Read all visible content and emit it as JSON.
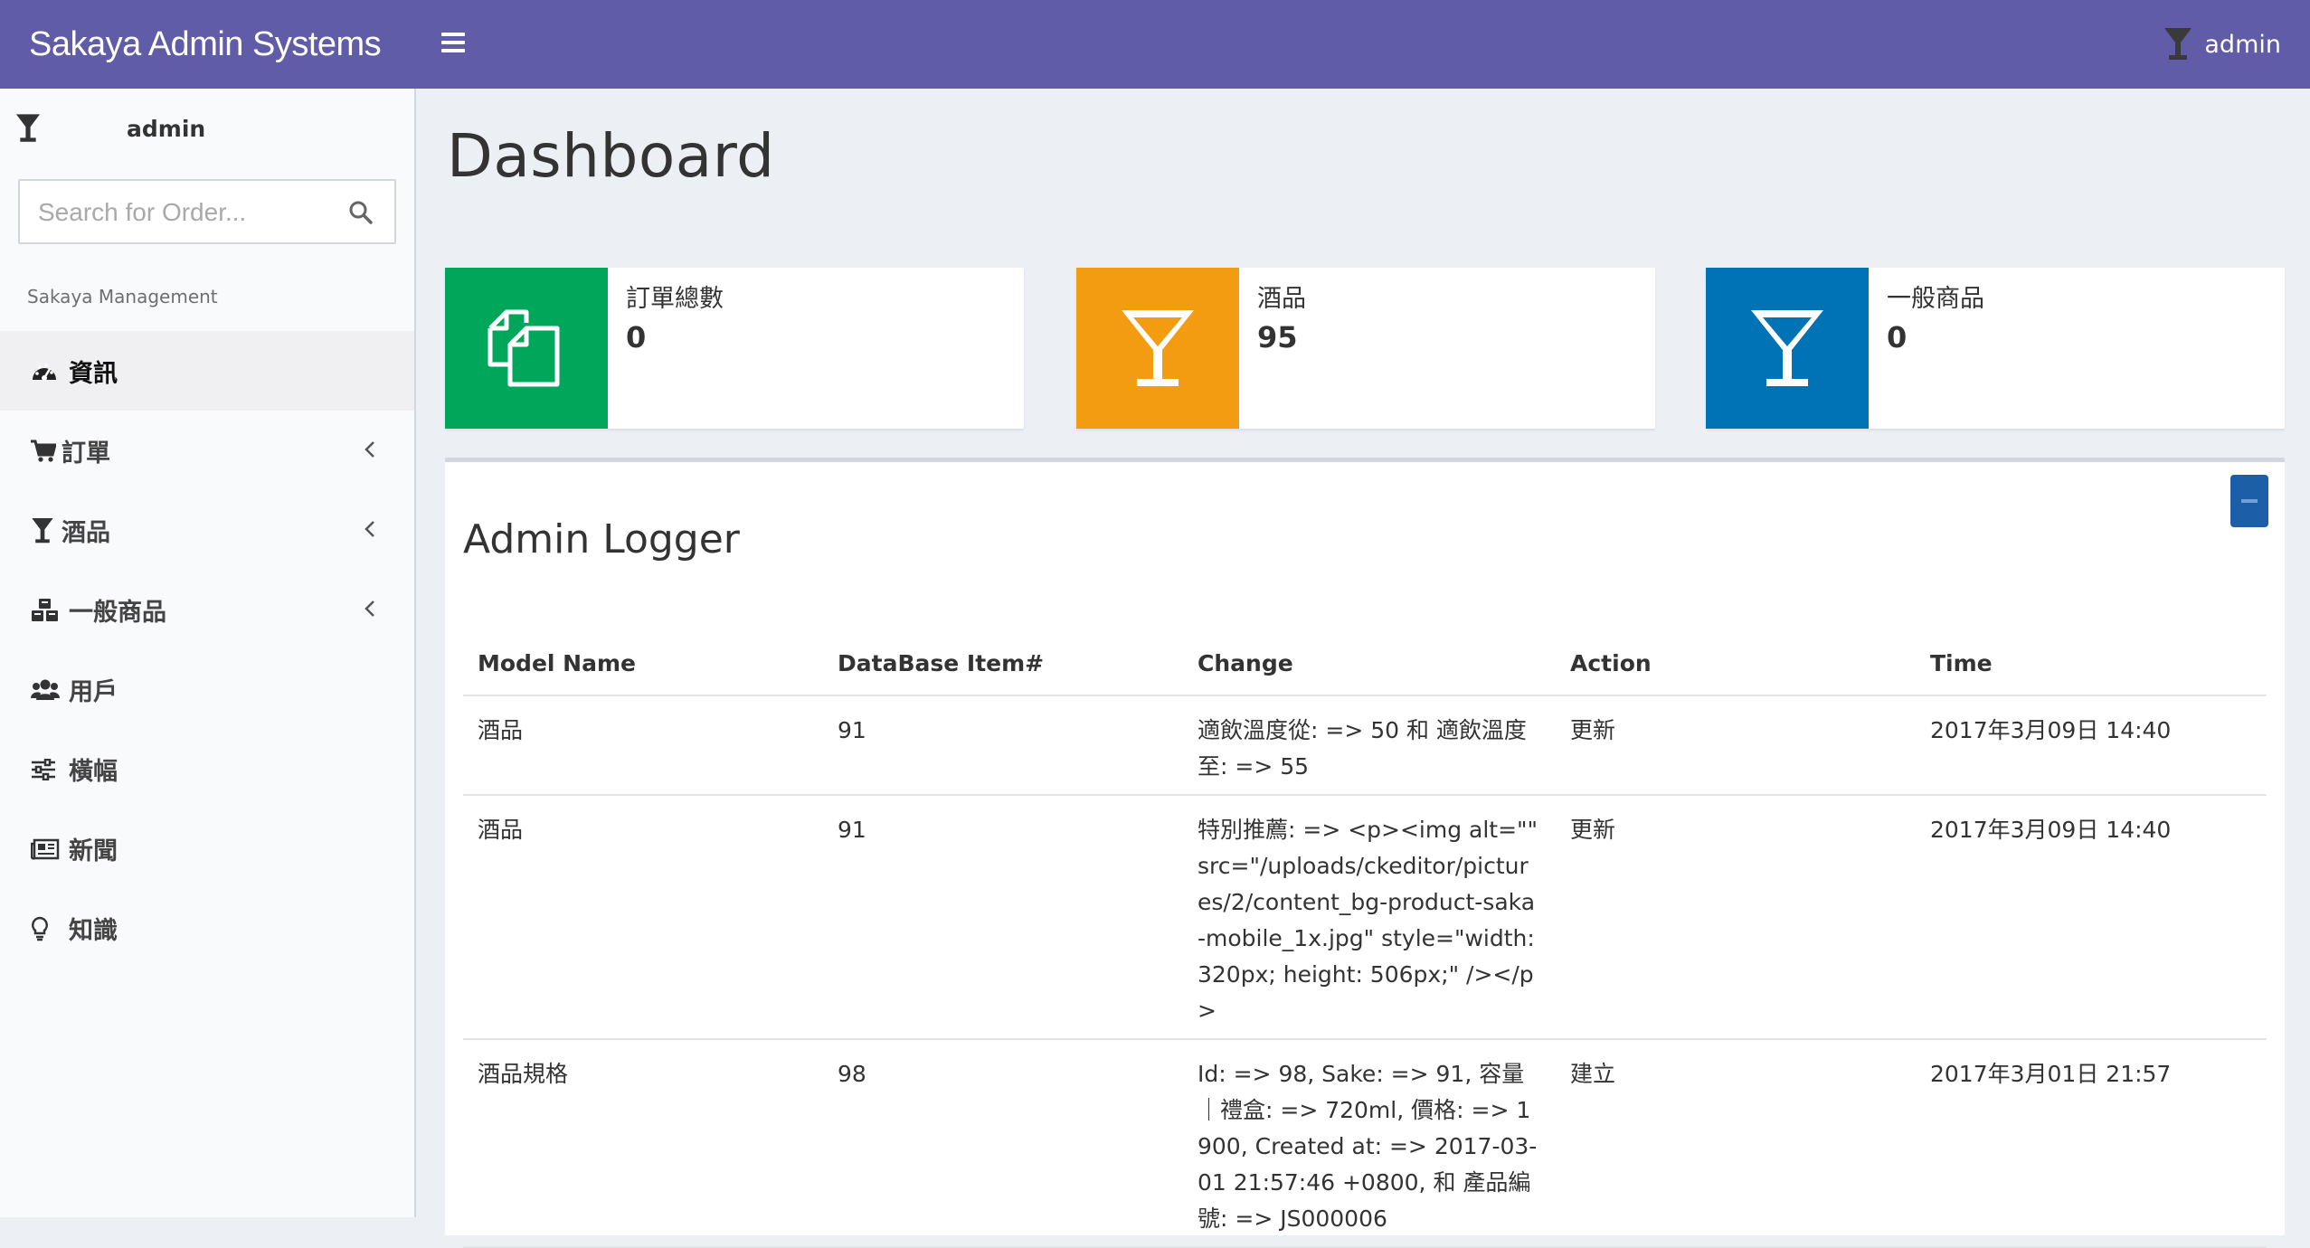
{
  "header": {
    "brand": "Sakaya Admin Systems",
    "user": "admin"
  },
  "sidebar": {
    "user_name": "admin",
    "search_placeholder": "Search for Order...",
    "section_header": "Sakaya Management",
    "items": [
      {
        "label": "資訊",
        "icon": "dashboard-icon",
        "active": true
      },
      {
        "label": "訂單",
        "icon": "cart-icon",
        "expandable": true
      },
      {
        "label": "酒品",
        "icon": "glass-icon",
        "expandable": true
      },
      {
        "label": "一般商品",
        "icon": "cubes-icon",
        "expandable": true
      },
      {
        "label": "用戶",
        "icon": "users-icon"
      },
      {
        "label": "橫幅",
        "icon": "sliders-icon"
      },
      {
        "label": "新聞",
        "icon": "newspaper-icon"
      },
      {
        "label": "知識",
        "icon": "lightbulb-icon"
      }
    ]
  },
  "main": {
    "title": "Dashboard",
    "info_boxes": [
      {
        "label": "訂單總數",
        "value": "0",
        "color": "#00a65a",
        "icon": "copy-icon"
      },
      {
        "label": "酒品",
        "value": "95",
        "color": "#f39c12",
        "icon": "glass-icon"
      },
      {
        "label": "一般商品",
        "value": "0",
        "color": "#0073b7",
        "icon": "glass-icon"
      }
    ],
    "logger": {
      "title": "Admin Logger",
      "columns": [
        "Model Name",
        "DataBase Item#",
        "Change",
        "Action",
        "Time"
      ],
      "rows": [
        {
          "model": "酒品",
          "item": "91",
          "change": "適飲溫度從: => 50 和 適飲溫度至: => 55",
          "action": "更新",
          "time": "2017年3月09日 14:40"
        },
        {
          "model": "酒品",
          "item": "91",
          "change": "特別推薦: => <p><img alt=\"\" src=\"/uploads/ckeditor/pictures/2/content_bg-product-saka-mobile_1x.jpg\" style=\"width: 320px; height: 506px;\" /></p>",
          "action": "更新",
          "time": "2017年3月09日 14:40"
        },
        {
          "model": "酒品規格",
          "item": "98",
          "change": "Id: => 98, Sake: => 91, 容量｜禮盒: => 720ml, 價格: => 1900, Created at: => 2017-03-01 21:57:46 +0800, 和 產品編號: => JS000006",
          "action": "建立",
          "time": "2017年3月01日 21:57"
        }
      ]
    }
  }
}
